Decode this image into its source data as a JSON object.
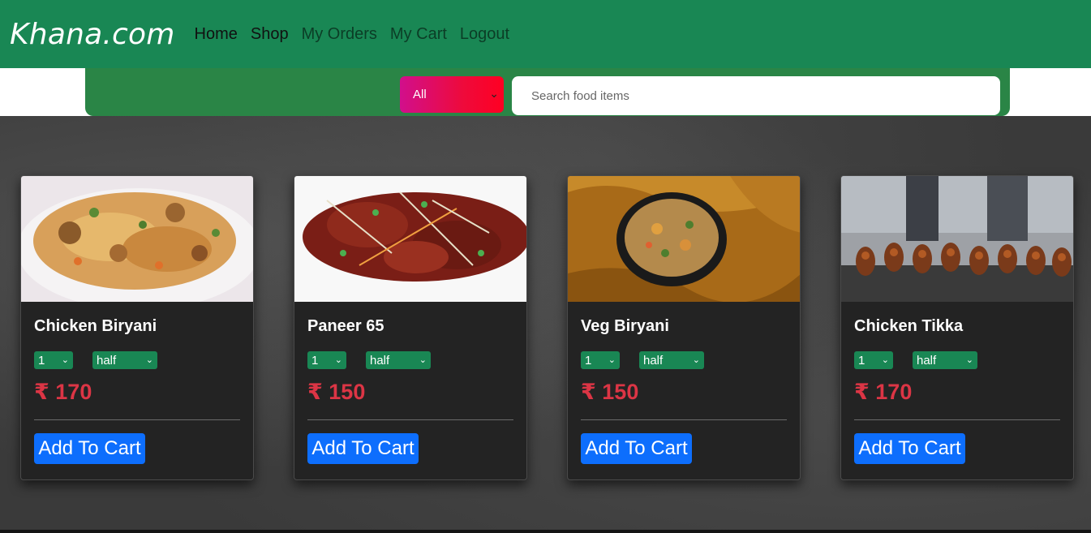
{
  "brand": "Khana.com",
  "nav": {
    "items": [
      {
        "label": "Home",
        "active": true
      },
      {
        "label": "Shop",
        "active": true
      },
      {
        "label": "My Orders",
        "active": false
      },
      {
        "label": "My Cart",
        "active": false
      },
      {
        "label": "Logout",
        "active": false
      }
    ]
  },
  "search": {
    "category_value": "All",
    "placeholder": "Search food items"
  },
  "currency": "₹",
  "products": [
    {
      "name": "Chicken Biryani",
      "qty": "1",
      "size": "half",
      "price": "₹ 170",
      "button": "Add To Cart"
    },
    {
      "name": "Paneer 65",
      "qty": "1",
      "size": "half",
      "price": "₹ 150",
      "button": "Add To Cart"
    },
    {
      "name": "Veg Biryani",
      "qty": "1",
      "size": "half",
      "price": "₹ 150",
      "button": "Add To Cart"
    },
    {
      "name": "Chicken Tikka",
      "qty": "1",
      "size": "half",
      "price": "₹ 170",
      "button": "Add To Cart"
    }
  ],
  "colors": {
    "navbar": "#198754",
    "search_strip": "#2a8546",
    "price": "#dc3545",
    "button": "#0d6efd",
    "card_bg": "#232323"
  }
}
